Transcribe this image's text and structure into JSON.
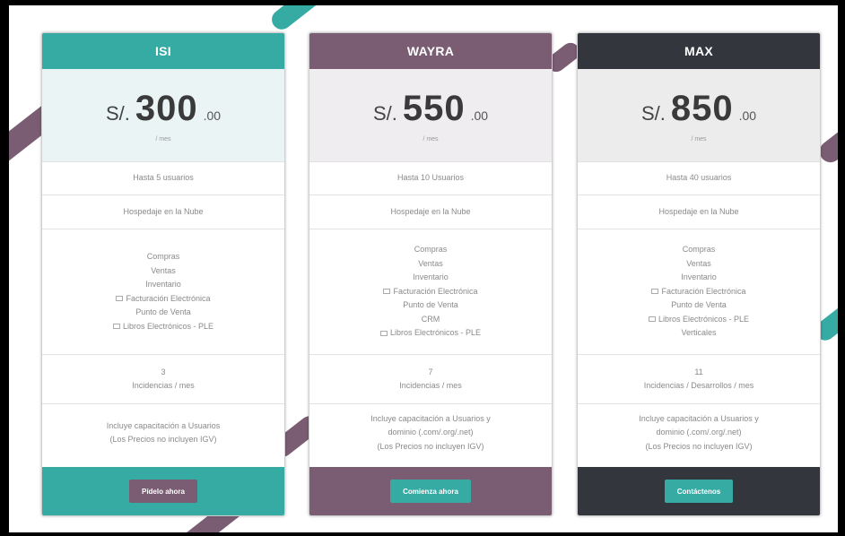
{
  "colors": {
    "teal": "#36aba4",
    "mauve": "#7a5d73",
    "dark": "#33363c",
    "teal_light_bg": "#eaf4f5",
    "mauve_light_bg": "#efedef",
    "dark_light_bg": "#ececec"
  },
  "plans": [
    {
      "name": "ISI",
      "currency": "S/.",
      "amount": "300",
      "cents": ".00",
      "period": "/ mes",
      "users": "Hasta 5 usuarios",
      "hosting": "Hospedaje en la Nube",
      "modules": [
        "Compras",
        "Ventas",
        "Inventario",
        "Facturación Electrónica",
        "Punto de Venta",
        "Libros Electrónicos - PLE"
      ],
      "incidents_count": "3",
      "incidents_label": "Incidencias / mes",
      "extra_line1": "Incluye capacitación a Usuarios",
      "extra_line2": "(Los Precios no incluyen IGV)",
      "button": "Pídelo ahora"
    },
    {
      "name": "WAYRA",
      "currency": "S/.",
      "amount": "550",
      "cents": ".00",
      "period": "/ mes",
      "users": "Hasta 10 Usuarios",
      "hosting": "Hospedaje en la Nube",
      "modules": [
        "Compras",
        "Ventas",
        "Inventario",
        "Facturación Electrónica",
        "Punto de Venta",
        "CRM",
        "Libros Electrónicos - PLE"
      ],
      "incidents_count": "7",
      "incidents_label": "Incidencias / mes",
      "extra_line1": "Incluye capacitación a Usuarios y",
      "extra_line2": "dominio (.com/.org/.net)",
      "extra_line3": "(Los Precios no incluyen IGV)",
      "button": "Comienza ahora"
    },
    {
      "name": "MAX",
      "currency": "S/.",
      "amount": "850",
      "cents": ".00",
      "period": "/ mes",
      "users": "Hasta 40 usuarios",
      "hosting": "Hospedaje en la Nube",
      "modules": [
        "Compras",
        "Ventas",
        "Inventario",
        "Facturación Electrónica",
        "Punto de Venta",
        "Libros Electrónicos - PLE",
        "Verticales"
      ],
      "incidents_count": "11",
      "incidents_label": "Incidencias / Desarrollos / mes",
      "extra_line1": "Incluye capacitación a Usuarios y",
      "extra_line2": "dominio (.com/.org/.net)",
      "extra_line3": "(Los Precios no incluyen IGV)",
      "button": "Contáctenos"
    }
  ]
}
